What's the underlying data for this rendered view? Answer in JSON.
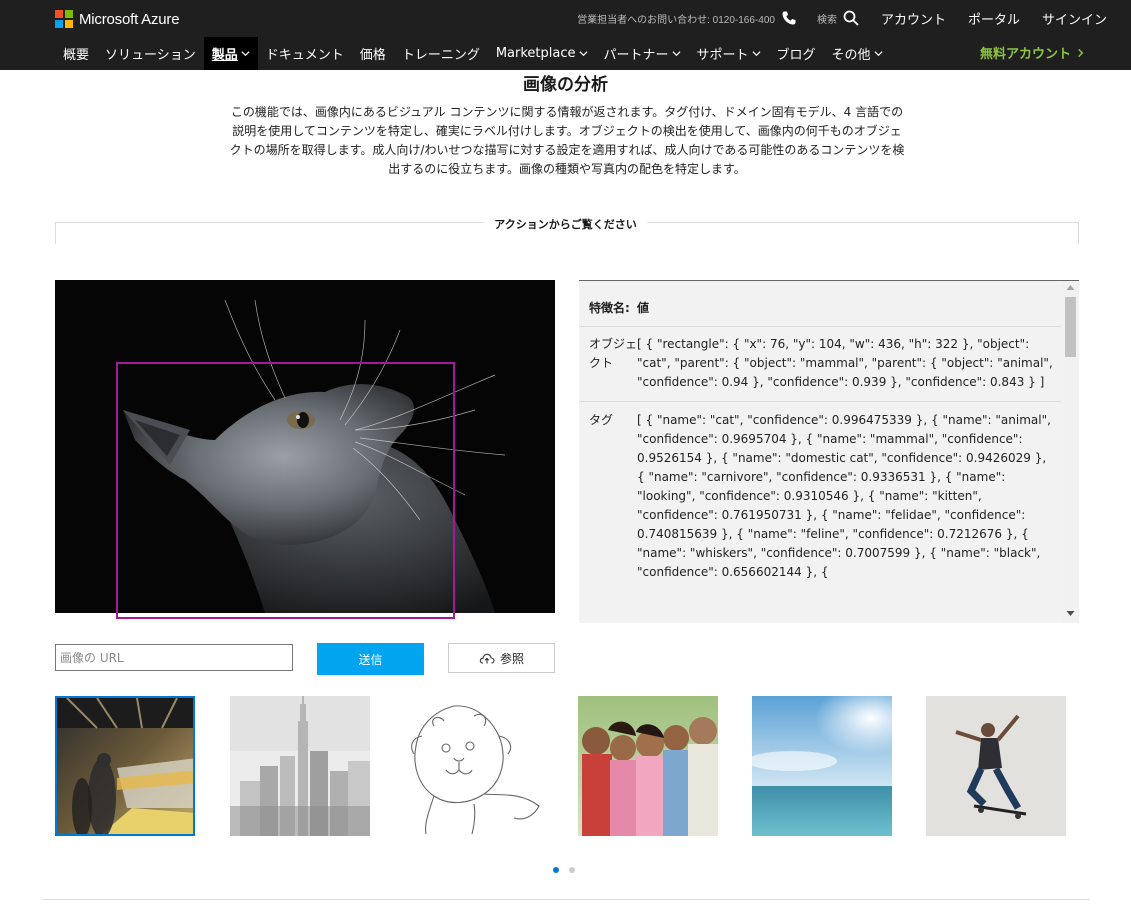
{
  "header": {
    "brand": "Microsoft Azure",
    "logo_colors": [
      "#f25022",
      "#7fba00",
      "#00a4ef",
      "#ffb900"
    ],
    "contact": "営業担当者へのお問い合わせ: 0120-166-400",
    "search_label": "検索",
    "links": [
      "アカウント",
      "ポータル",
      "サインイン"
    ]
  },
  "nav": {
    "items": [
      {
        "label": "概要",
        "dropdown": false,
        "active": false
      },
      {
        "label": "ソリューション",
        "dropdown": false,
        "active": false
      },
      {
        "label": "製品",
        "dropdown": true,
        "active": true
      },
      {
        "label": "ドキュメント",
        "dropdown": false,
        "active": false
      },
      {
        "label": "価格",
        "dropdown": false,
        "active": false
      },
      {
        "label": "トレーニング",
        "dropdown": false,
        "active": false
      },
      {
        "label": "Marketplace",
        "dropdown": true,
        "active": false
      },
      {
        "label": "パートナー",
        "dropdown": true,
        "active": false
      },
      {
        "label": "サポート",
        "dropdown": true,
        "active": false
      },
      {
        "label": "ブログ",
        "dropdown": false,
        "active": false
      },
      {
        "label": "その他",
        "dropdown": true,
        "active": false
      }
    ],
    "free_account": "無料アカウント",
    "accent": "#8dc63f"
  },
  "main": {
    "title": "画像の分析",
    "description": "この機能では、画像内にあるビジュアル コンテンツに関する情報が返されます。タグ付け、ドメイン固有モデル、4 言語での説明を使用してコンテンツを特定し、確実にラベル付けします。オブジェクトの検出を使用して、画像内の何千ものオブジェクトの場所を取得します。成人向け/わいせつな描写に対する設定を適用すれば、成人向けである可能性のあるコンテンツを検出するのに役立ちます。画像の種類や写真内の配色を特定します。",
    "action_label": "アクションからご覧ください"
  },
  "results": {
    "header": {
      "key": "特徴名:",
      "value": "値"
    },
    "rows": [
      {
        "key": "オブジェクト",
        "value": "[ { \"rectangle\": { \"x\": 76, \"y\": 104, \"w\": 436, \"h\": 322 }, \"object\": \"cat\", \"parent\": { \"object\": \"mammal\", \"parent\": { \"object\": \"animal\", \"confidence\": 0.94 }, \"confidence\": 0.939 }, \"confidence\": 0.843 } ]"
      },
      {
        "key": "タグ",
        "value": "[ { \"name\": \"cat\", \"confidence\": 0.996475339 }, { \"name\": \"animal\", \"confidence\": 0.9695704 }, { \"name\": \"mammal\", \"confidence\": 0.9526154 }, { \"name\": \"domestic cat\", \"confidence\": 0.9426029 }, { \"name\": \"carnivore\", \"confidence\": 0.9336531 }, { \"name\": \"looking\", \"confidence\": 0.9310546 }, { \"name\": \"kitten\", \"confidence\": 0.761950731 }, { \"name\": \"felidae\", \"confidence\": 0.740815639 }, { \"name\": \"feline\", \"confidence\": 0.7212676 }, { \"name\": \"whiskers\", \"confidence\": 0.7007599 }, { \"name\": \"black\", \"confidence\": 0.656602144 }, {"
      }
    ]
  },
  "controls": {
    "url_placeholder": "画像の URL",
    "submit_label": "送信",
    "browse_label": "参照",
    "submit_color": "#00a4ef"
  },
  "carousel": {
    "thumbnails": [
      "subway-station-photo",
      "city-skyline-photo",
      "lion-line-drawing",
      "family-photo",
      "ocean-sky-photo",
      "skateboarder-photo"
    ],
    "selected_index": 0,
    "page_count": 2,
    "active_page": 1
  },
  "colors": {
    "bounding_box": "#a21a99",
    "selection": "#0078d4"
  }
}
